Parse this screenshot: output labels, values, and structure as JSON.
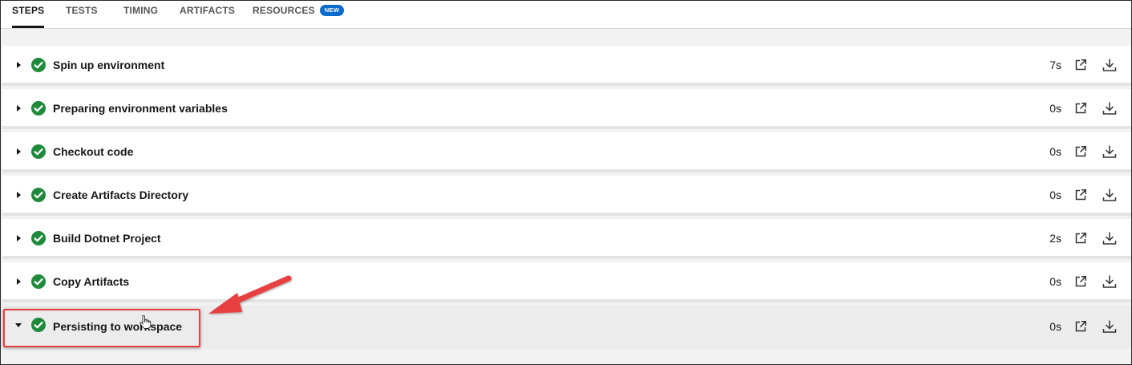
{
  "tabs": [
    {
      "label": "STEPS",
      "active": true
    },
    {
      "label": "TESTS",
      "active": false
    },
    {
      "label": "TIMING",
      "active": false
    },
    {
      "label": "ARTIFACTS",
      "active": false
    },
    {
      "label": "RESOURCES",
      "active": false,
      "badge": "NEW"
    }
  ],
  "steps": [
    {
      "name": "Spin up environment",
      "duration": "7s",
      "status": "success",
      "expanded": false
    },
    {
      "name": "Preparing environment variables",
      "duration": "0s",
      "status": "success",
      "expanded": false
    },
    {
      "name": "Checkout code",
      "duration": "0s",
      "status": "success",
      "expanded": false
    },
    {
      "name": "Create Artifacts Directory",
      "duration": "0s",
      "status": "success",
      "expanded": false
    },
    {
      "name": "Build Dotnet Project",
      "duration": "2s",
      "status": "success",
      "expanded": false
    },
    {
      "name": "Copy Artifacts",
      "duration": "0s",
      "status": "success",
      "expanded": false
    },
    {
      "name": "Persisting to workspace",
      "duration": "0s",
      "status": "success",
      "expanded": true
    }
  ],
  "colors": {
    "success": "#1f8a3b",
    "badge": "#0b6bcb",
    "annotation": "#e8403f"
  },
  "icons": {
    "caret_collapsed": "caret-right-icon",
    "caret_expanded": "caret-down-icon",
    "status": "check-circle-icon",
    "open": "open-in-new-icon",
    "download": "download-icon"
  }
}
